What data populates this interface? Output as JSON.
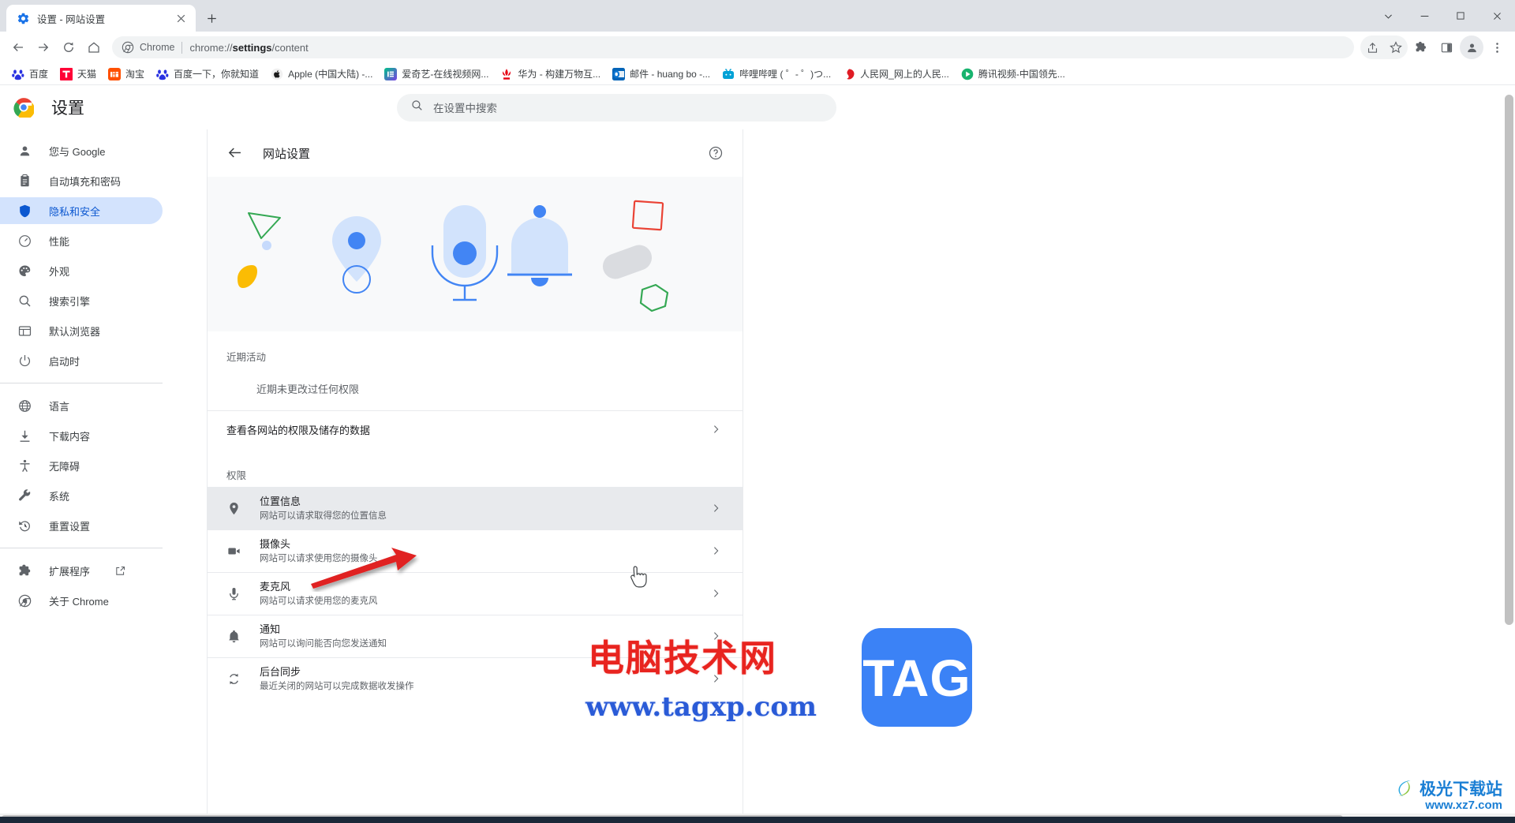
{
  "window": {
    "controls": {
      "expand": "chevron-down",
      "minimize": "minimize",
      "maximize": "maximize",
      "close": "close"
    }
  },
  "tabstrip": {
    "tabs": [
      {
        "title": "设置 - 网站设置",
        "favicon": "settings-gear-icon",
        "close_label": "✕"
      }
    ],
    "new_tab_label": "+"
  },
  "toolbar": {
    "back": "back-icon",
    "forward": "forward-icon",
    "reload": "reload-icon",
    "home": "home-icon",
    "omnibox": {
      "chip_label": "Chrome",
      "url_prefix": "chrome://",
      "url_bold": "settings",
      "url_suffix": "/content",
      "full_url": "chrome://settings/content"
    },
    "right_icons": [
      "share-icon",
      "star-icon",
      "extensions-icon",
      "side-panel-icon",
      "profile-icon",
      "menu-icon"
    ]
  },
  "bookmarks": [
    {
      "label": "百度",
      "icon": "baidu-icon"
    },
    {
      "label": "天猫",
      "icon": "tmall-icon"
    },
    {
      "label": "淘宝",
      "icon": "taobao-icon"
    },
    {
      "label": "百度一下，你就知道",
      "icon": "baidu-icon"
    },
    {
      "label": "Apple (中国大陆) -...",
      "icon": "apple-icon"
    },
    {
      "label": "爱奇艺-在线视频网...",
      "icon": "iqiyi-icon"
    },
    {
      "label": "华为 - 构建万物互...",
      "icon": "huawei-icon"
    },
    {
      "label": "邮件 - huang bo -...",
      "icon": "outlook-icon"
    },
    {
      "label": "哔哩哔哩 ( ゜- ゜)つ...",
      "icon": "bilibili-icon"
    },
    {
      "label": "人民网_网上的人民...",
      "icon": "people-icon"
    },
    {
      "label": "腾讯视频-中国领先...",
      "icon": "tencent-video-icon"
    }
  ],
  "settings_header": {
    "logo": "chrome-logo-icon",
    "title": "设置",
    "search": {
      "placeholder": "在设置中搜索",
      "value": "",
      "icon": "search-icon"
    }
  },
  "sidebar": {
    "groups": [
      {
        "items": [
          {
            "label": "您与 Google",
            "icon": "person-icon",
            "active": false
          },
          {
            "label": "自动填充和密码",
            "icon": "clipboard-icon",
            "active": false
          },
          {
            "label": "隐私和安全",
            "icon": "shield-icon",
            "active": true
          },
          {
            "label": "性能",
            "icon": "speedometer-icon",
            "active": false
          },
          {
            "label": "外观",
            "icon": "palette-icon",
            "active": false
          },
          {
            "label": "搜索引擎",
            "icon": "search-icon",
            "active": false
          },
          {
            "label": "默认浏览器",
            "icon": "browser-window-icon",
            "active": false
          },
          {
            "label": "启动时",
            "icon": "power-icon",
            "active": false
          }
        ]
      },
      {
        "items": [
          {
            "label": "语言",
            "icon": "globe-icon",
            "active": false
          },
          {
            "label": "下载内容",
            "icon": "download-icon",
            "active": false
          },
          {
            "label": "无障碍",
            "icon": "accessibility-icon",
            "active": false
          },
          {
            "label": "系统",
            "icon": "wrench-icon",
            "active": false
          },
          {
            "label": "重置设置",
            "icon": "history-restore-icon",
            "active": false
          }
        ]
      },
      {
        "items": [
          {
            "label": "扩展程序",
            "icon": "puzzle-icon",
            "active": false,
            "external": true
          },
          {
            "label": "关于 Chrome",
            "icon": "chrome-circle-icon",
            "active": false
          }
        ]
      }
    ]
  },
  "main": {
    "header": {
      "back_icon": "back-arrow-icon",
      "title": "网站设置",
      "help_icon": "help-circle-icon"
    },
    "recent_activity": {
      "section_label": "近期活动",
      "empty_text": "近期未更改过任何权限"
    },
    "view_all_row": {
      "label": "查看各网站的权限及储存的数据",
      "chevron": "chevron-right-icon"
    },
    "permissions": {
      "section_label": "权限",
      "rows": [
        {
          "title": "位置信息",
          "desc": "网站可以请求取得您的位置信息",
          "icon": "location-pin-icon",
          "hovered": true
        },
        {
          "title": "摄像头",
          "desc": "网站可以请求使用您的摄像头",
          "icon": "camera-icon",
          "hovered": false
        },
        {
          "title": "麦克风",
          "desc": "网站可以请求使用您的麦克风",
          "icon": "microphone-icon",
          "hovered": false
        },
        {
          "title": "通知",
          "desc": "网站可以询问能否向您发送通知",
          "icon": "bell-icon",
          "hovered": false
        },
        {
          "title": "后台同步",
          "desc": "最近关闭的网站可以完成数据收发操作",
          "icon": "sync-icon",
          "hovered": false
        }
      ]
    }
  },
  "watermarks": {
    "red_text": "电脑技术网",
    "blue_url": "www.tagxp.com",
    "tag_badge": "TAG",
    "jiguang_name": "极光下载站",
    "jiguang_url": "www.xz7.com"
  },
  "colors": {
    "accent": "#1a73e8",
    "active_nav_bg": "#d3e3fd",
    "active_nav_fg": "#0b57d0",
    "hover_row_bg": "#e8eaed",
    "hero_bg": "#f8f9fa",
    "illustration_light_blue": "#d2e3fc",
    "illustration_blue": "#4285f4",
    "illustration_green": "#34a853",
    "illustration_yellow": "#fbbc04",
    "illustration_red": "#ea4335",
    "illustration_gray": "#dadce0",
    "annotation_red": "#e02020",
    "watermark_blue": "#3b82f6"
  }
}
